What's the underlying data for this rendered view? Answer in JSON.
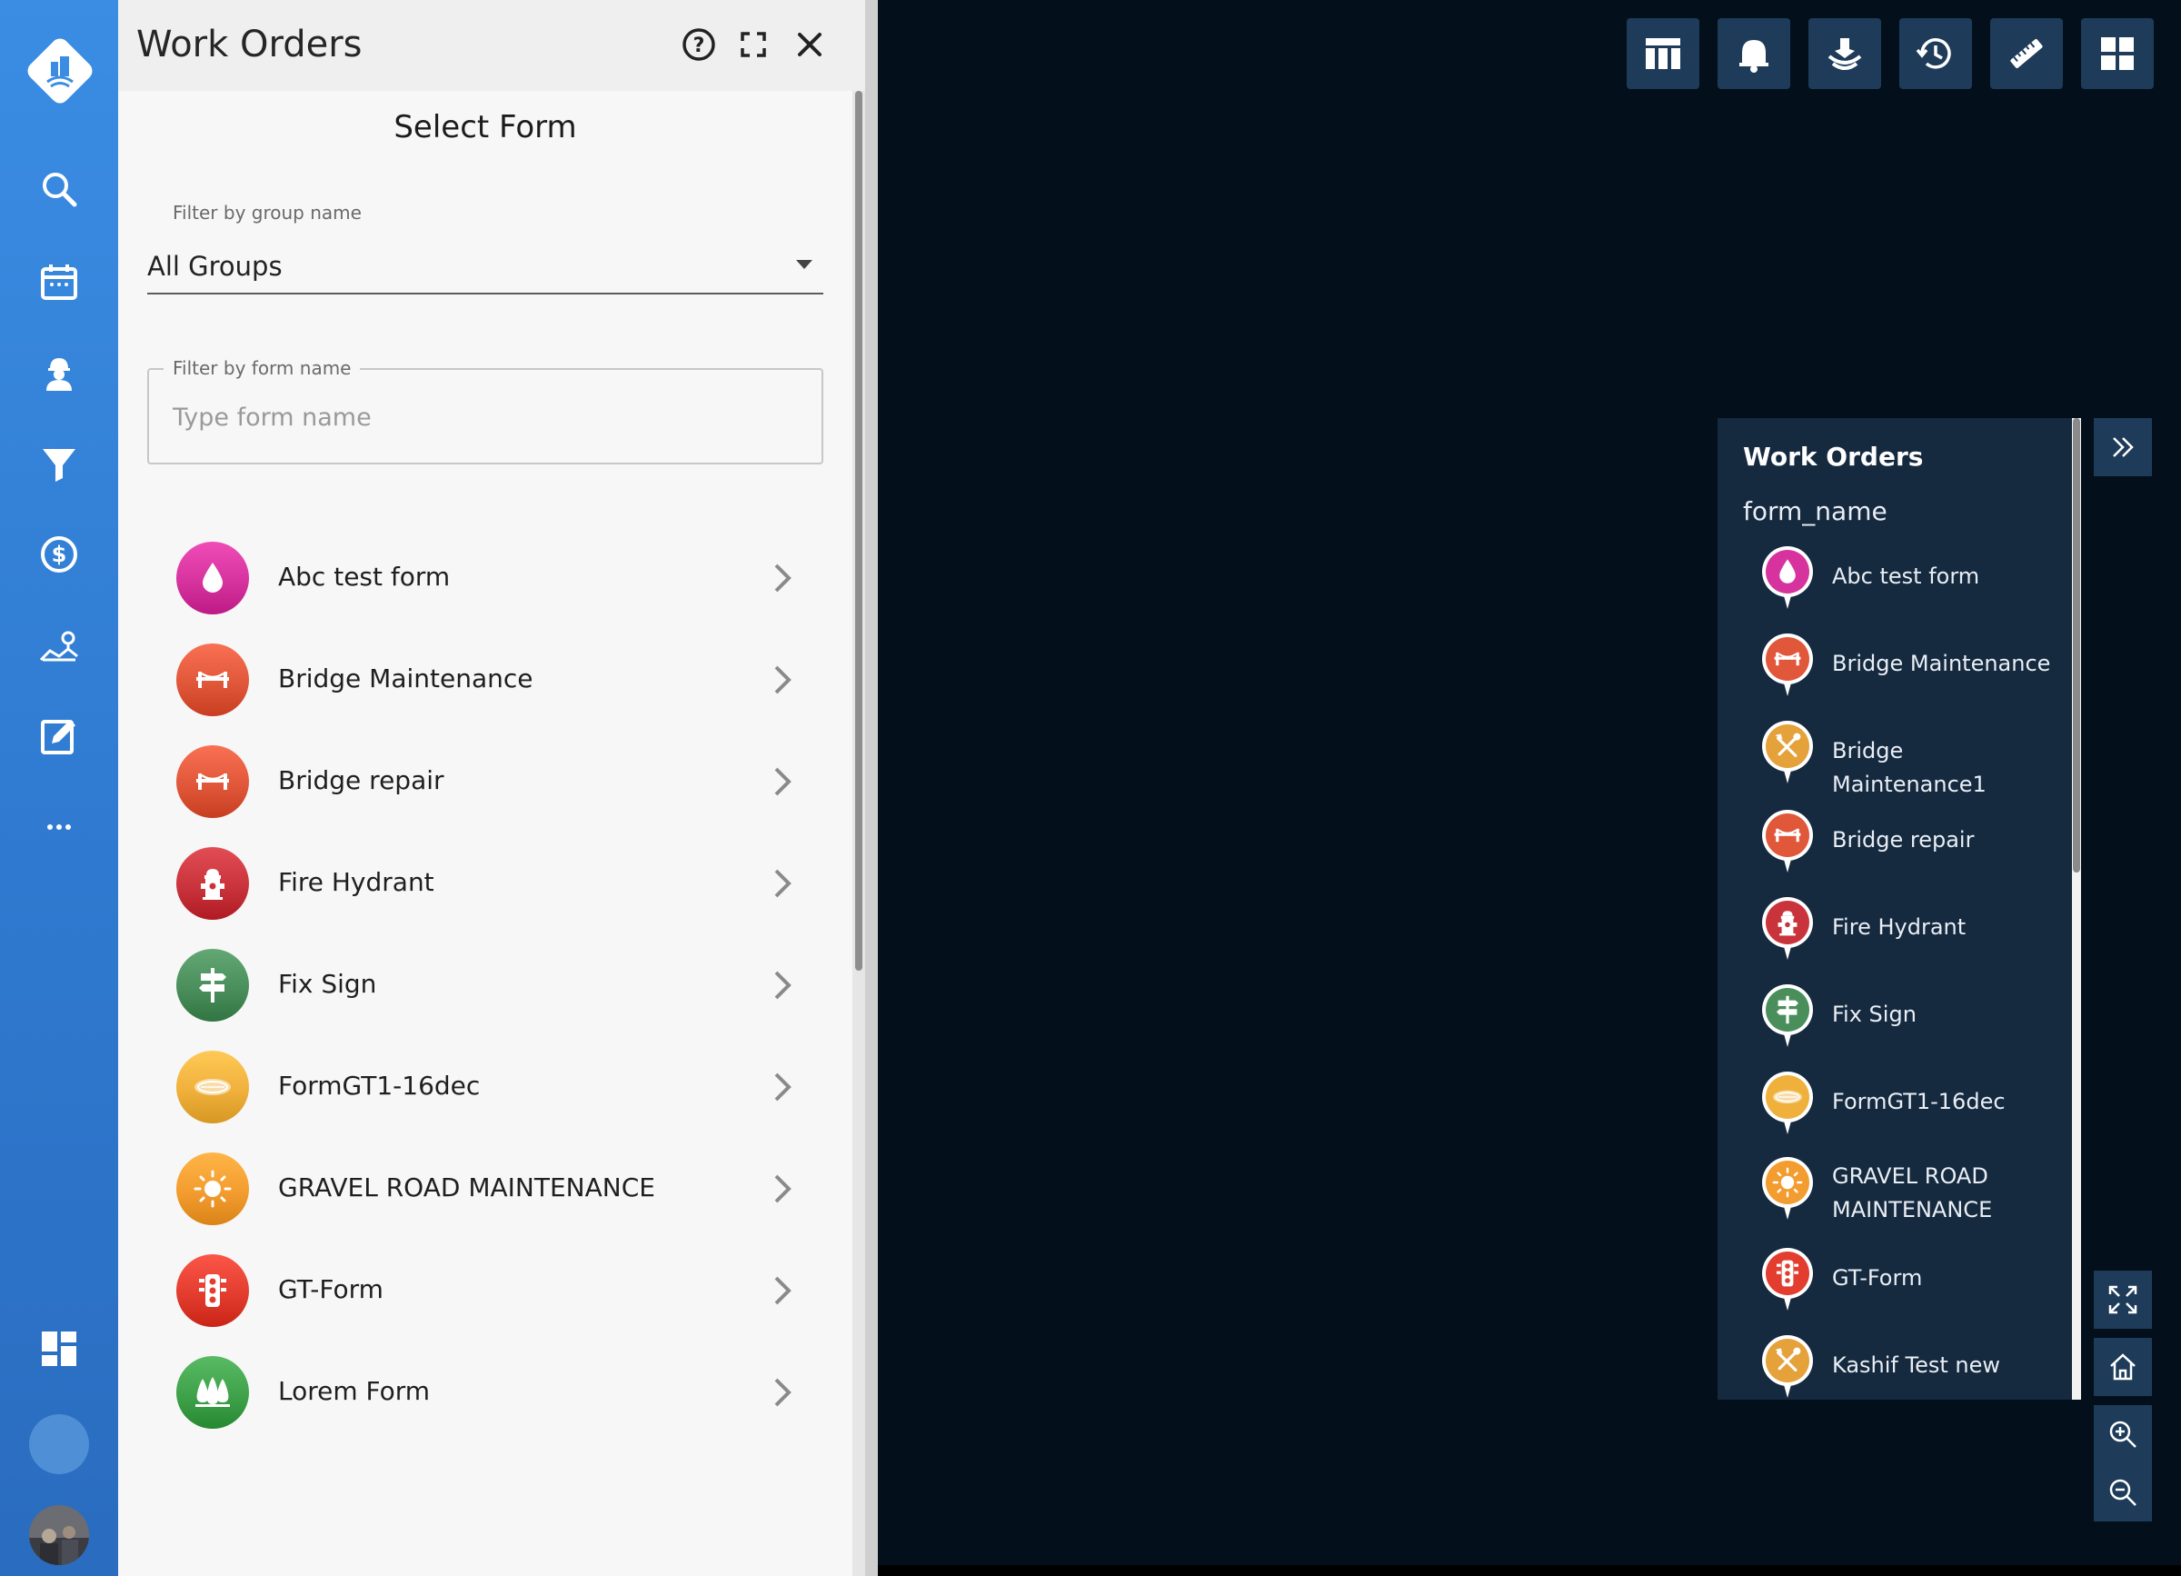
{
  "panel": {
    "title": "Work Orders",
    "select_form_title": "Select Form",
    "group_filter": {
      "label": "Filter by group name",
      "value": "All Groups"
    },
    "name_filter": {
      "label": "Filter by form name",
      "placeholder": "Type form name",
      "value": ""
    },
    "forms": [
      {
        "label": "Abc test form",
        "color": "#d6339e",
        "icon": "drop-icon"
      },
      {
        "label": "Bridge Maintenance",
        "color": "#e0573a",
        "icon": "bridge-icon"
      },
      {
        "label": "Bridge repair",
        "color": "#e0573a",
        "icon": "bridge-icon"
      },
      {
        "label": "Fire Hydrant",
        "color": "#c9343c",
        "icon": "hydrant-icon"
      },
      {
        "label": "Fix Sign",
        "color": "#4a8f5b",
        "icon": "signpost-icon"
      },
      {
        "label": "FormGT1-16dec",
        "color": "#f0b03c",
        "icon": "manhole-icon"
      },
      {
        "label": "GRAVEL ROAD MAINTENANCE",
        "color": "#f39c2f",
        "icon": "sun-icon"
      },
      {
        "label": "GT-Form",
        "color": "#e23d2f",
        "icon": "traffic-light-icon"
      },
      {
        "label": "Lorem Form",
        "color": "#3fa24a",
        "icon": "trees-icon"
      }
    ]
  },
  "map_legend": {
    "title": "Work Orders",
    "field": "form_name",
    "items": [
      {
        "label": "Abc test form",
        "color": "#d6339e",
        "icon": "drop-icon"
      },
      {
        "label": "Bridge Maintenance",
        "color": "#e0573a",
        "icon": "bridge-icon"
      },
      {
        "label": "Bridge Maintenance1",
        "color": "#e5a13a",
        "icon": "tools-icon"
      },
      {
        "label": "Bridge repair",
        "color": "#e0573a",
        "icon": "bridge-icon"
      },
      {
        "label": "Fire Hydrant",
        "color": "#c9343c",
        "icon": "hydrant-icon"
      },
      {
        "label": "Fix Sign",
        "color": "#4a8f5b",
        "icon": "signpost-icon"
      },
      {
        "label": "FormGT1-16dec",
        "color": "#f0b03c",
        "icon": "manhole-icon"
      },
      {
        "label": "GRAVEL ROAD MAINTENANCE",
        "color": "#f39c2f",
        "icon": "sun-icon"
      },
      {
        "label": "GT-Form",
        "color": "#e23d2f",
        "icon": "traffic-light-icon"
      },
      {
        "label": "Kashif Test new",
        "color": "#e5a13a",
        "icon": "tools-icon"
      }
    ]
  },
  "toolbar": {
    "items": [
      "table-icon",
      "bell-icon",
      "layers-icon",
      "history-icon",
      "ruler-icon",
      "grid-icon"
    ]
  },
  "nav": {
    "items": [
      "search-icon",
      "calendar-icon",
      "worker-icon",
      "filter-icon",
      "dollar-icon",
      "map-pin-icon",
      "edit-icon",
      "more-icon",
      "dashboard-icon"
    ]
  },
  "colors": {
    "rail": "#3a8de3",
    "map_bg": "#030f1b",
    "control_bg": "#1e3c5a",
    "legend_bg": "#15293f"
  }
}
